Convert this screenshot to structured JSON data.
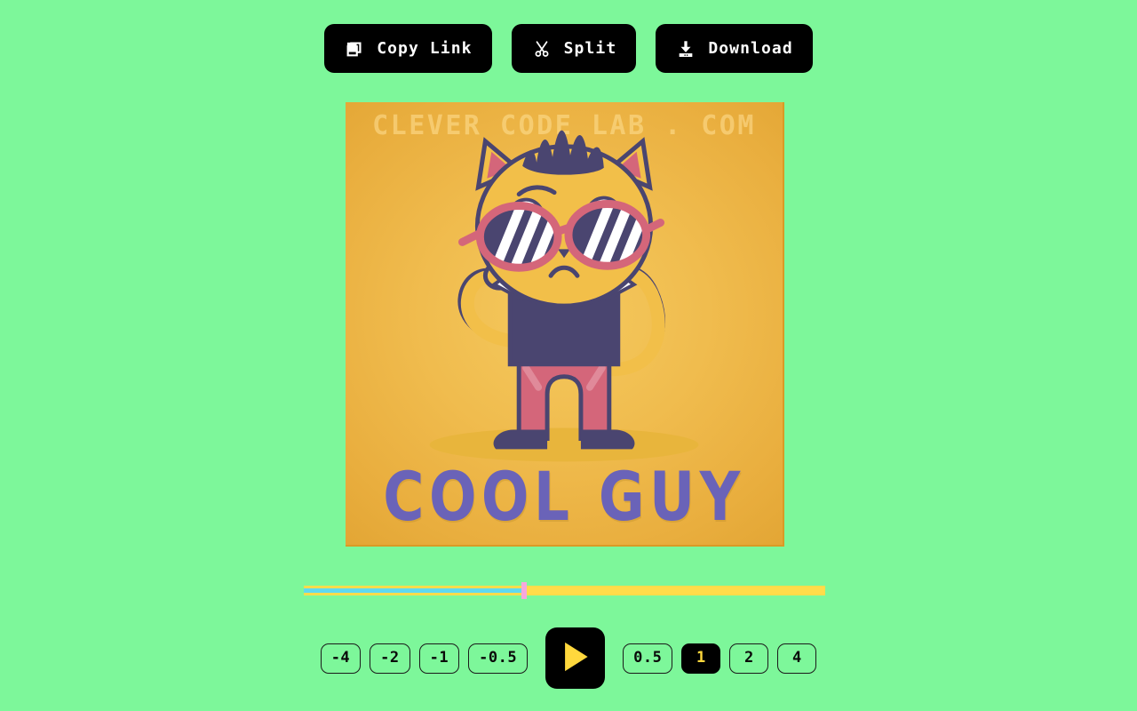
{
  "theme": {
    "background": "#7df79a",
    "button_bg": "#000000",
    "button_text": "#ffffff",
    "accent_yellow": "#ffd83d",
    "track_yellow": "#ffdc4a",
    "track_cyan": "#5fd9f0",
    "playhead_pink": "#f6a8dc",
    "image_bg": "#f0bc4e"
  },
  "toolbar": {
    "buttons": [
      {
        "label": "Copy Link",
        "icon": "copy-icon"
      },
      {
        "label": "Split",
        "icon": "scissors-icon"
      },
      {
        "label": "Download",
        "icon": "download-icon"
      }
    ]
  },
  "preview": {
    "watermark": "CLEVER CODE LAB . COM",
    "caption": "COOL GUY",
    "alt": "Cartoon cat character wearing sunglasses, bow tie and vest",
    "colors": {
      "body": "#f2bf49",
      "body_dark": "#e0a932",
      "outline": "#4a4570",
      "vest": "#4a4570",
      "pants": "#d4667a",
      "accent_pink": "#d4667a",
      "hair": "#4a4570",
      "white": "#ffffff",
      "caption_color": "#6a63b8",
      "ground": "#e8b53c"
    }
  },
  "timeline": {
    "position_percent": 42.2,
    "playhead_label": "playhead"
  },
  "controls": {
    "rewind_speeds": [
      "-4",
      "-2",
      "-1",
      "-0.5"
    ],
    "forward_speeds": [
      "0.5",
      "1",
      "2",
      "4"
    ],
    "active_speed": "1",
    "play_label": "Play"
  }
}
